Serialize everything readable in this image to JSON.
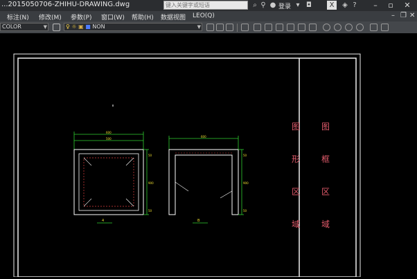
{
  "app": {
    "title": "...2015050706-ZHIHU-DRAWING.dwg",
    "search_placeholder": "键入关键字或短语",
    "login_label": "登录",
    "x_label": "X"
  },
  "menu": {
    "items": [
      "标注(N)",
      "修改(M)",
      "参数(P)",
      "窗口(W)",
      "帮助(H)",
      "数据视图",
      "LEO(Q)"
    ]
  },
  "toolbar": {
    "color_combo": "COLOR",
    "layer_combo": "NON"
  },
  "drawing": {
    "plan": {
      "top_dims": [
        "600",
        "500"
      ],
      "side_dims": [
        "50",
        "900",
        "50"
      ],
      "bottom_label": "4"
    },
    "section": {
      "top_dim": "600",
      "side_dims": [
        "50",
        "900",
        "50"
      ],
      "bottom_label": "B"
    },
    "title_block": {
      "col1": [
        "图",
        "形",
        "区",
        "域"
      ],
      "col2": [
        "图",
        "框",
        "区",
        "域"
      ]
    },
    "colors": {
      "line": "#f0f0f0",
      "dim": "#30d030",
      "geometry": "#ffffff",
      "hidden": "#e04040",
      "label": "#f0e030",
      "title_text": "#e05a6a"
    }
  }
}
